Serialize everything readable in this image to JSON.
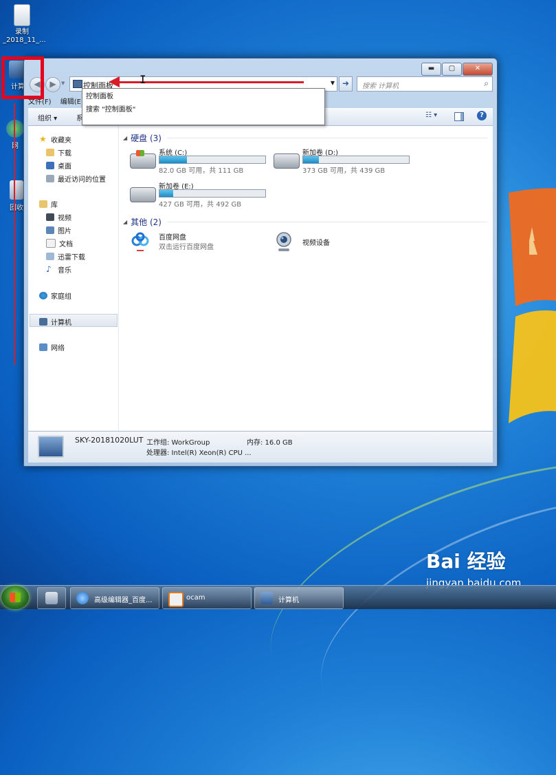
{
  "desktop": {
    "icons": [
      {
        "label": "录制\n_2018_11_..."
      },
      {
        "label": "计算"
      },
      {
        "label": "网"
      },
      {
        "label": "回收"
      }
    ]
  },
  "window": {
    "controls": {
      "minimize": "▬",
      "maximize": "▢",
      "close": "✕"
    },
    "address": {
      "value": "控制面板"
    },
    "search": {
      "placeholder": "搜索 计算机"
    },
    "autocomplete": [
      "控制面板",
      "搜索 \"控制面板\""
    ],
    "menubar": [
      "文件(F)",
      "编辑(E)"
    ],
    "toolbar": {
      "organize": "组织 ▾",
      "second": "系"
    },
    "sidebar": {
      "favorites": {
        "label": "收藏夹",
        "items": [
          "下载",
          "桌面",
          "最近访问的位置"
        ]
      },
      "libraries": {
        "label": "库",
        "items": [
          "视频",
          "图片",
          "文档",
          "迅雷下载",
          "音乐"
        ]
      },
      "homegroup": "家庭组",
      "computer": "计算机",
      "network": "网络"
    },
    "drives_group": "硬盘 (3)",
    "drives": [
      {
        "name": "系统 (C:)",
        "info": "82.0 GB 可用，共 111 GB",
        "used_fraction": 0.26
      },
      {
        "name": "新加卷 (D:)",
        "info": "373 GB 可用，共 439 GB",
        "used_fraction": 0.15
      },
      {
        "name": "新加卷 (E:)",
        "info": "427 GB 可用，共 492 GB",
        "used_fraction": 0.13
      }
    ],
    "other_group": "其他 (2)",
    "other_items": [
      {
        "name": "百度网盘",
        "sub": "双击运行百度网盘"
      },
      {
        "name": "视频设备",
        "sub": ""
      }
    ],
    "details": {
      "computer_name": "SKY-20181020LUT",
      "workgroup": "工作组: WorkGroup",
      "memory": "内存: 16.0 GB",
      "processor": "处理器: Intel(R) Xeon(R) CPU ..."
    }
  },
  "taskbar": {
    "items": [
      "高级编辑器_百度...",
      "ocam",
      "计算机"
    ]
  },
  "watermark": {
    "brand": "Bai 经验",
    "url": "jingyan.baidu.com"
  }
}
